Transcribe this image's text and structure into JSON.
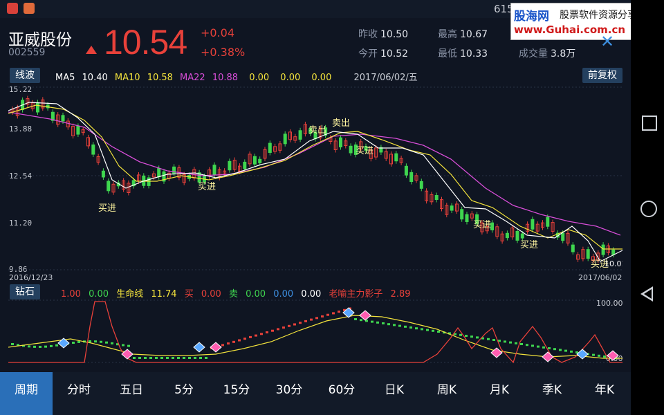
{
  "status": {
    "clock": "615"
  },
  "watermark": {
    "logo": "股海网",
    "tagline": "股票软件资源分享",
    "url": "www.Guhai.com.cn"
  },
  "stock": {
    "name": "亚威股份",
    "code": "002559",
    "price": "10.54",
    "change": "+0.04",
    "change_pct": "+0.38%",
    "prev_close_label": "昨收",
    "prev_close": "10.50",
    "open_label": "今开",
    "open": "10.52",
    "high_label": "最高",
    "high": "10.67",
    "low_label": "最低",
    "low": "10.33",
    "volume_label": "成交量",
    "volume": "3.8万",
    "up_color": "#e8413a"
  },
  "main_chart": {
    "indicator_button": "线波",
    "adjust_button": "前复权",
    "ma_legend": [
      {
        "name": "MA5",
        "value": "10.40",
        "color": "#ffffff"
      },
      {
        "name": "MA10",
        "value": "10.58",
        "color": "#f3e33c"
      },
      {
        "name": "MA22",
        "value": "10.88",
        "color": "#d84ed8"
      }
    ],
    "extra_values": [
      "0.00",
      "0.00",
      "0.00"
    ],
    "cursor_date": "2017/06/02/五",
    "price_ticks": [
      "15.22",
      "13.88",
      "12.54",
      "11.20",
      "9.86"
    ],
    "start_date": "2016/12/23",
    "end_date": "2017/06/02",
    "last_label": "10.01",
    "buy_label": "买进",
    "sell_label": "卖出"
  },
  "sub_chart": {
    "indicator_button": "钻石",
    "values": [
      {
        "text": "1.00",
        "color": "#e8413a"
      },
      {
        "text": "0.00",
        "color": "#3fd64f"
      },
      {
        "text": "生命线",
        "color": "#f3e33c"
      },
      {
        "text": "11.74",
        "color": "#f3e33c"
      },
      {
        "text": "买",
        "color": "#e8413a"
      },
      {
        "text": "0.00",
        "color": "#e8413a"
      },
      {
        "text": "卖",
        "color": "#3fd64f"
      },
      {
        "text": "0.00",
        "color": "#3fd64f"
      },
      {
        "text": "0.00",
        "color": "#3d8fe0"
      },
      {
        "text": "0.00",
        "color": "#ffffff"
      },
      {
        "text": "老喻主力影子",
        "color": "#e8413a"
      },
      {
        "text": "2.89",
        "color": "#e8413a"
      }
    ],
    "axis_max": "100.00",
    "axis_min": "0.00"
  },
  "tabs": [
    {
      "label": "周期",
      "active": true
    },
    {
      "label": "分时"
    },
    {
      "label": "五日"
    },
    {
      "label": "5分"
    },
    {
      "label": "15分"
    },
    {
      "label": "30分"
    },
    {
      "label": "60分"
    },
    {
      "label": "日K",
      "selected": true
    },
    {
      "label": "周K"
    },
    {
      "label": "月K"
    },
    {
      "label": "季K"
    },
    {
      "label": "年K"
    }
  ]
}
